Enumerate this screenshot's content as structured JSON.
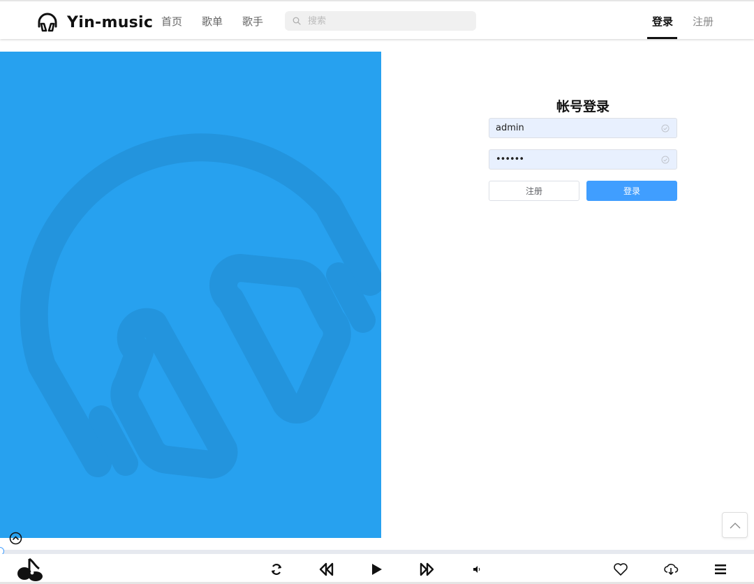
{
  "header": {
    "brand": "Yin-music",
    "nav": [
      {
        "label": "首页"
      },
      {
        "label": "歌单"
      },
      {
        "label": "歌手"
      }
    ],
    "search": {
      "placeholder": "搜索",
      "icon": "search-icon"
    },
    "login_label": "登录",
    "register_label": "注册"
  },
  "login": {
    "title": "帐号登录",
    "username": "admin",
    "password": "••••••",
    "register_button": "注册",
    "login_button": "登录"
  },
  "colors": {
    "banner": "#27a1ef",
    "banner_mark": "#2394dd",
    "primary": "#409eff"
  },
  "player": {
    "progress": 0,
    "icons": [
      "album-cover-icon",
      "loop-icon",
      "previous-icon",
      "play-icon",
      "next-icon",
      "volume-icon",
      "favorite-icon",
      "download-icon",
      "playlist-icon"
    ]
  }
}
